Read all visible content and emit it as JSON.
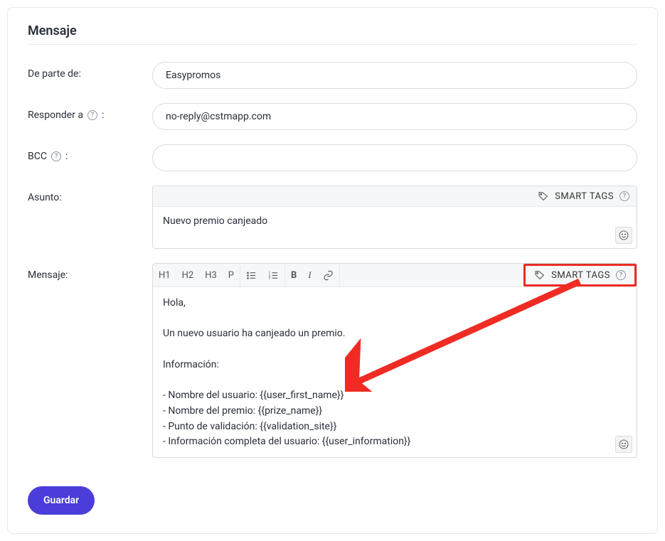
{
  "title": "Mensaje",
  "labels": {
    "from": "De parte de:",
    "replyTo": "Responder a",
    "bcc": "BCC",
    "subject": "Asunto:",
    "message": "Mensaje:"
  },
  "values": {
    "from": "Easypromos",
    "replyTo": "no-reply@cstmapp.com",
    "bcc": "",
    "subject": "Nuevo premio canjeado"
  },
  "smartTags": "SMART TAGS",
  "toolbar": {
    "h1": "H1",
    "h2": "H2",
    "h3": "H3",
    "p": "P",
    "b": "B",
    "i": "I"
  },
  "messageBody": {
    "greeting": "Hola,",
    "intro": "Un nuevo usuario ha canjeado un premio.",
    "infoHeader": "Información:",
    "lines": [
      "- Nombre del usuario: {{user_first_name}}",
      "- Nombre del premio: {{prize_name}}",
      "- Punto de validación: {{validation_site}}",
      "- Información completa del usuario: {{user_information}}"
    ]
  },
  "save": "Guardar"
}
